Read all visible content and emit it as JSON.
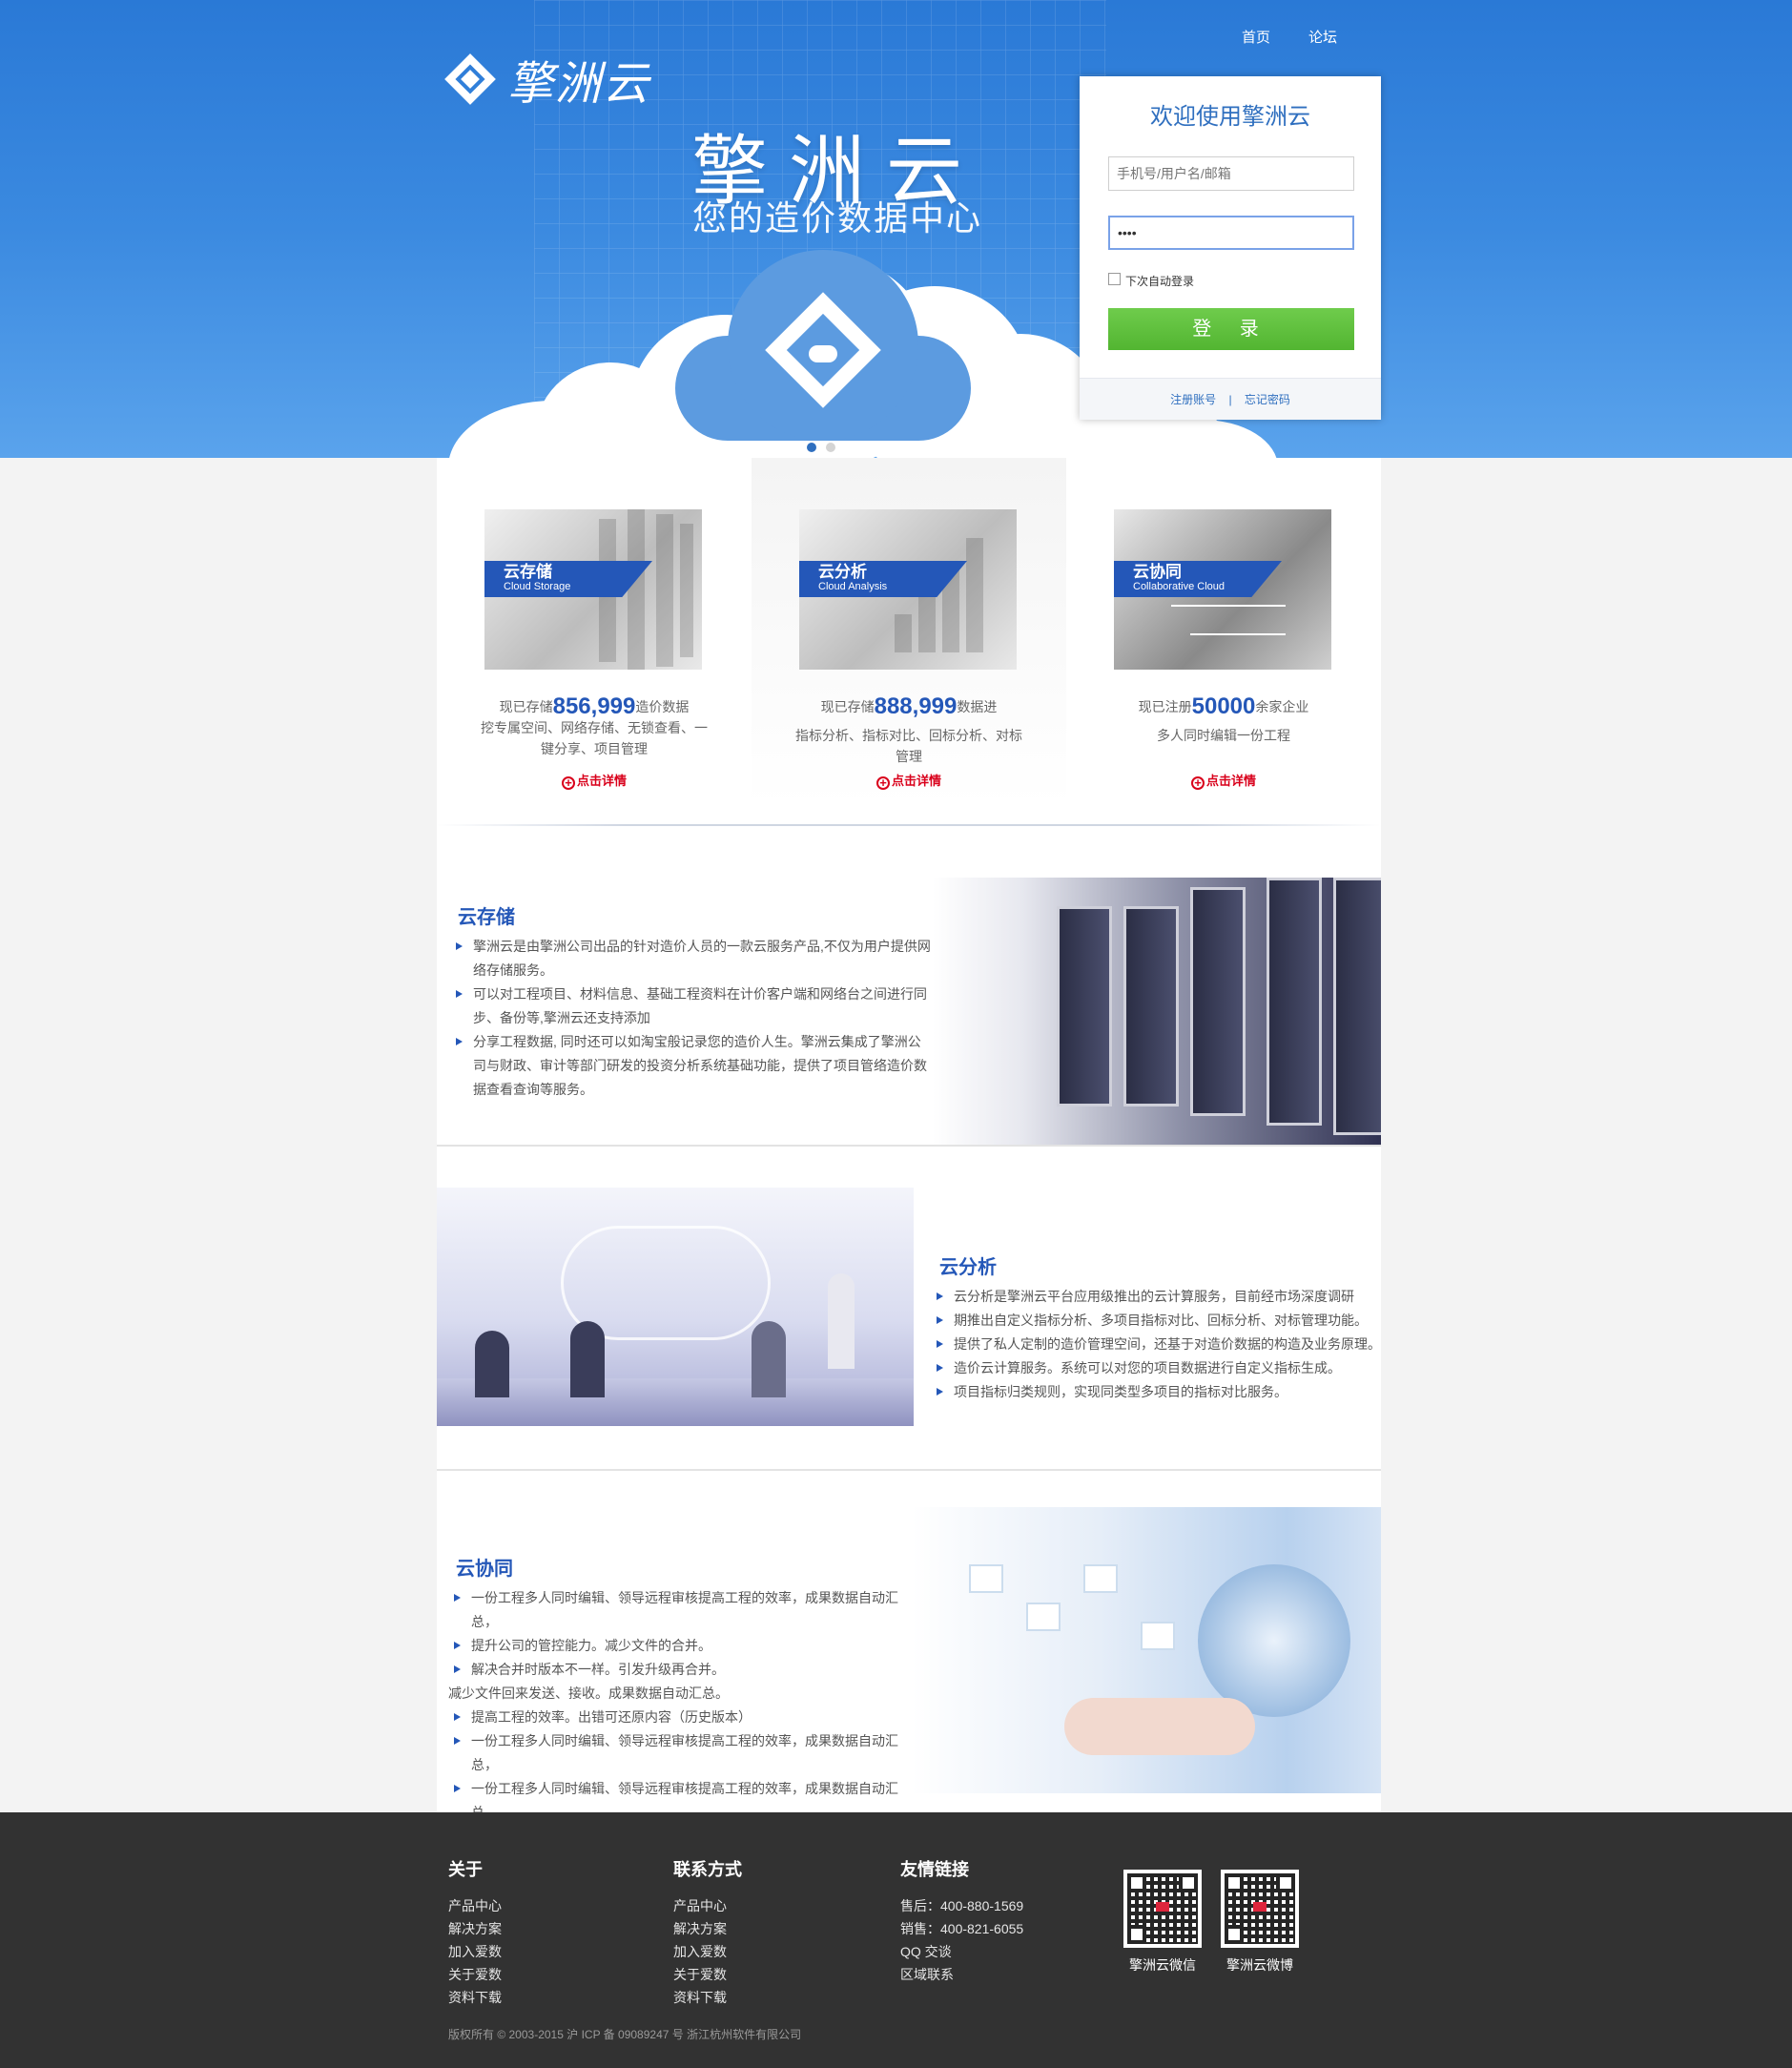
{
  "nav": {
    "home": "首页",
    "forum": "论坛"
  },
  "brand": {
    "logo_text": "擎洲云"
  },
  "hero": {
    "title": "擎洲云",
    "subtitle": "您的造价数据中心"
  },
  "login": {
    "title": "欢迎使用擎洲云",
    "username_placeholder": "手机号/用户名/邮箱",
    "password_value": "1234",
    "remember_label": "下次自动登录",
    "submit_label": "登 录",
    "register_link": "注册账号",
    "separator": "|",
    "forgot_link": "忘记密码"
  },
  "carousel": {
    "active_index": 1,
    "count": 2,
    "colors": {
      "active": "#2f6fbf",
      "inactive": "#d4d4d4"
    }
  },
  "features": [
    {
      "title": "云存储",
      "subtitle": "Cloud Storage",
      "prefix": "现已存储",
      "number": "856,999",
      "suffix": "造价数据",
      "desc": "挖专属空间、网络存储、无锁查看、一键分享、项目管理",
      "more": "点击详情"
    },
    {
      "title": "云分析",
      "subtitle": "Cloud Analysis",
      "prefix": "现已存储",
      "number": "888,999",
      "suffix": "数据进",
      "desc": "指标分析、指标对比、回标分析、对标管理",
      "more": "点击详情"
    },
    {
      "title": "云协同",
      "subtitle": "Collaborative Cloud",
      "prefix": "现已注册",
      "number": "50000",
      "suffix": "余家企业",
      "desc": "多人同时编辑一份工程",
      "more": "点击详情"
    }
  ],
  "sections": {
    "storage": {
      "title": "云存储",
      "items": [
        "擎洲云是由擎洲公司出品的针对造价人员的一款云服务产品,不仅为用户提供网络存储服务。",
        "可以对工程项目、材料信息、基础工程资料在计价客户端和网络台之间进行同步、备份等,擎洲云还支持添加",
        "分享工程数据, 同时还可以如淘宝般记录您的造价人生。擎洲云集成了擎洲公司与财政、审计等部门研发的投资分析系统基础功能，提供了项目管络造价数据查看查询等服务。"
      ]
    },
    "analysis": {
      "title": "云分析",
      "items": [
        "云分析是擎洲云平台应用级推出的云计算服务，目前经市场深度调研",
        "期推出自定义指标分析、多项目指标对比、回标分析、对标管理功能。",
        "提供了私人定制的造价管理空间，还基于对造价数据的构造及业务原理。",
        "造价云计算服务。系统可以对您的项目数据进行自定义指标生成。",
        "项目指标归类规则，实现同类型多项目的指标对比服务。"
      ]
    },
    "collab": {
      "title": "云协同",
      "items": [
        "一份工程多人同时编辑、领导远程审核提高工程的效率，成果数据自动汇总，",
        "提升公司的管控能力。减少文件的合并。",
        "解决合并时版本不一样。引发升级再合并。",
        "减少文件回来发送、接收。成果数据自动汇总。",
        "提高工程的效率。出错可还原内容（历史版本）",
        "一份工程多人同时编辑、领导远程审核提高工程的效率，成果数据自动汇总，",
        "一份工程多人同时编辑、领导远程审核提高工程的效率，成果数据自动汇总，"
      ]
    }
  },
  "footer": {
    "about": {
      "title": "关于",
      "links": [
        "产品中心",
        "解决方案",
        "加入爱数",
        "关于爱数",
        "资料下载"
      ]
    },
    "contact": {
      "title": "联系方式",
      "links": [
        "产品中心",
        "解决方案",
        "加入爱数",
        "关于爱数",
        "资料下载"
      ]
    },
    "friends": {
      "title": "友情链接",
      "links": [
        "售后：400-880-1569",
        "销售：400-821-6055",
        "QQ 交谈",
        "区域联系"
      ]
    },
    "qr": [
      {
        "label": "擎洲云微信"
      },
      {
        "label": "擎洲云微博"
      }
    ],
    "copyright": "版权所有 © 2003-2015 沪 ICP 备 09089247 号 浙江杭州软件有限公司"
  },
  "colors": {
    "brand_blue": "#2457b8",
    "login_green": "#5bbf3a",
    "footer_bg": "#323232",
    "hero_blue": "#3b8ae0"
  }
}
